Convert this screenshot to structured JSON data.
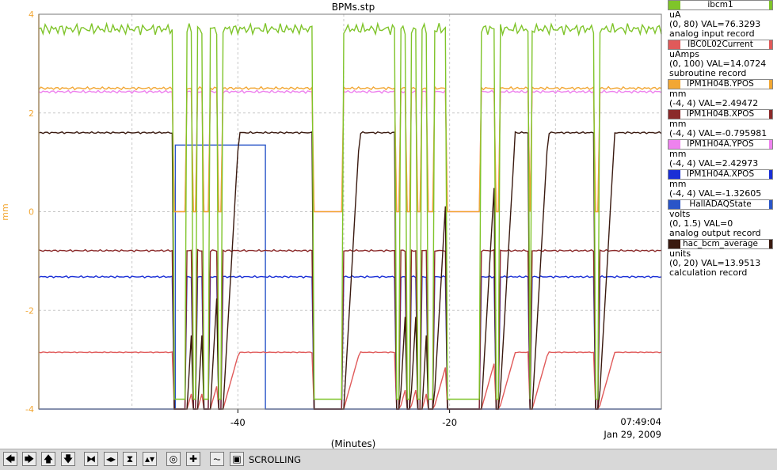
{
  "window": {
    "title": "BPMs.stp"
  },
  "chart_data": {
    "type": "line",
    "title": "BPMs.stp",
    "xlabel": "(Minutes)",
    "ylabel": "mm",
    "xlim": [
      -58.8,
      0
    ],
    "ylim": [
      -4,
      4
    ],
    "x_ticks": [
      -40,
      -20
    ],
    "y_ticks": [
      -4,
      -2,
      0,
      2,
      4
    ],
    "grid": true,
    "time_label": "07:49:04",
    "date_label": "Jan 29, 2009",
    "legend_position": "right",
    "series": [
      {
        "name": "ibcm1",
        "color": "#7fc42a",
        "unit": "uA",
        "range": [
          0,
          80
        ],
        "value_text": "VAL=76.3293",
        "record": "analog input record"
      },
      {
        "name": "IBC0L02Current",
        "color": "#e05a5a",
        "unit": "uAmps",
        "range": [
          0,
          100
        ],
        "value_text": "VAL=14.0724",
        "record": "subroutine record"
      },
      {
        "name": "IPM1H04B.YPOS",
        "color": "#f2a734",
        "unit": "mm",
        "range": [
          -4,
          4
        ],
        "value_text": "VAL=2.49472"
      },
      {
        "name": "IPM1H04B.XPOS",
        "color": "#8b2a2a",
        "unit": "mm",
        "range": [
          -4,
          4
        ],
        "value_text": "VAL=-0.795981"
      },
      {
        "name": "IPM1H04A.YPOS",
        "color": "#ee82ee",
        "unit": "mm",
        "range": [
          -4,
          4
        ],
        "value_text": "VAL=2.42973"
      },
      {
        "name": "IPM1H04A.XPOS",
        "color": "#1a2fd6",
        "unit": "mm",
        "range": [
          -4,
          4
        ],
        "value_text": "VAL=-1.32605"
      },
      {
        "name": "HallADAQState",
        "color": "#2a55c8",
        "unit": "volts",
        "range": [
          0,
          1.5
        ],
        "value_text": "VAL=0",
        "record": "analog output record"
      },
      {
        "name": "hac_bcm_average",
        "color": "#3a1a10",
        "unit": "units",
        "range": [
          0,
          20
        ],
        "value_text": "VAL=13.9513",
        "record": "calculation record"
      }
    ]
  },
  "toolbar": {
    "status": "SCROLLING",
    "buttons": [
      {
        "name": "scroll-left-button",
        "glyph": "🡄"
      },
      {
        "name": "scroll-right-button",
        "glyph": "🡆"
      },
      {
        "name": "scroll-up-button",
        "glyph": "🡅"
      },
      {
        "name": "scroll-down-button",
        "glyph": "🡇"
      },
      {
        "name": "zoom-in-x-button",
        "glyph": "⧓"
      },
      {
        "name": "zoom-out-x-button",
        "glyph": "◂▸"
      },
      {
        "name": "zoom-in-y-button",
        "glyph": "⧗"
      },
      {
        "name": "zoom-out-y-button",
        "glyph": "▴▾"
      },
      {
        "name": "auto-scale-button",
        "glyph": "◎"
      },
      {
        "name": "add-trace-button",
        "glyph": "✚"
      },
      {
        "name": "config-button",
        "glyph": "⏦"
      },
      {
        "name": "scrolling-toggle-button",
        "glyph": "▣"
      }
    ]
  }
}
